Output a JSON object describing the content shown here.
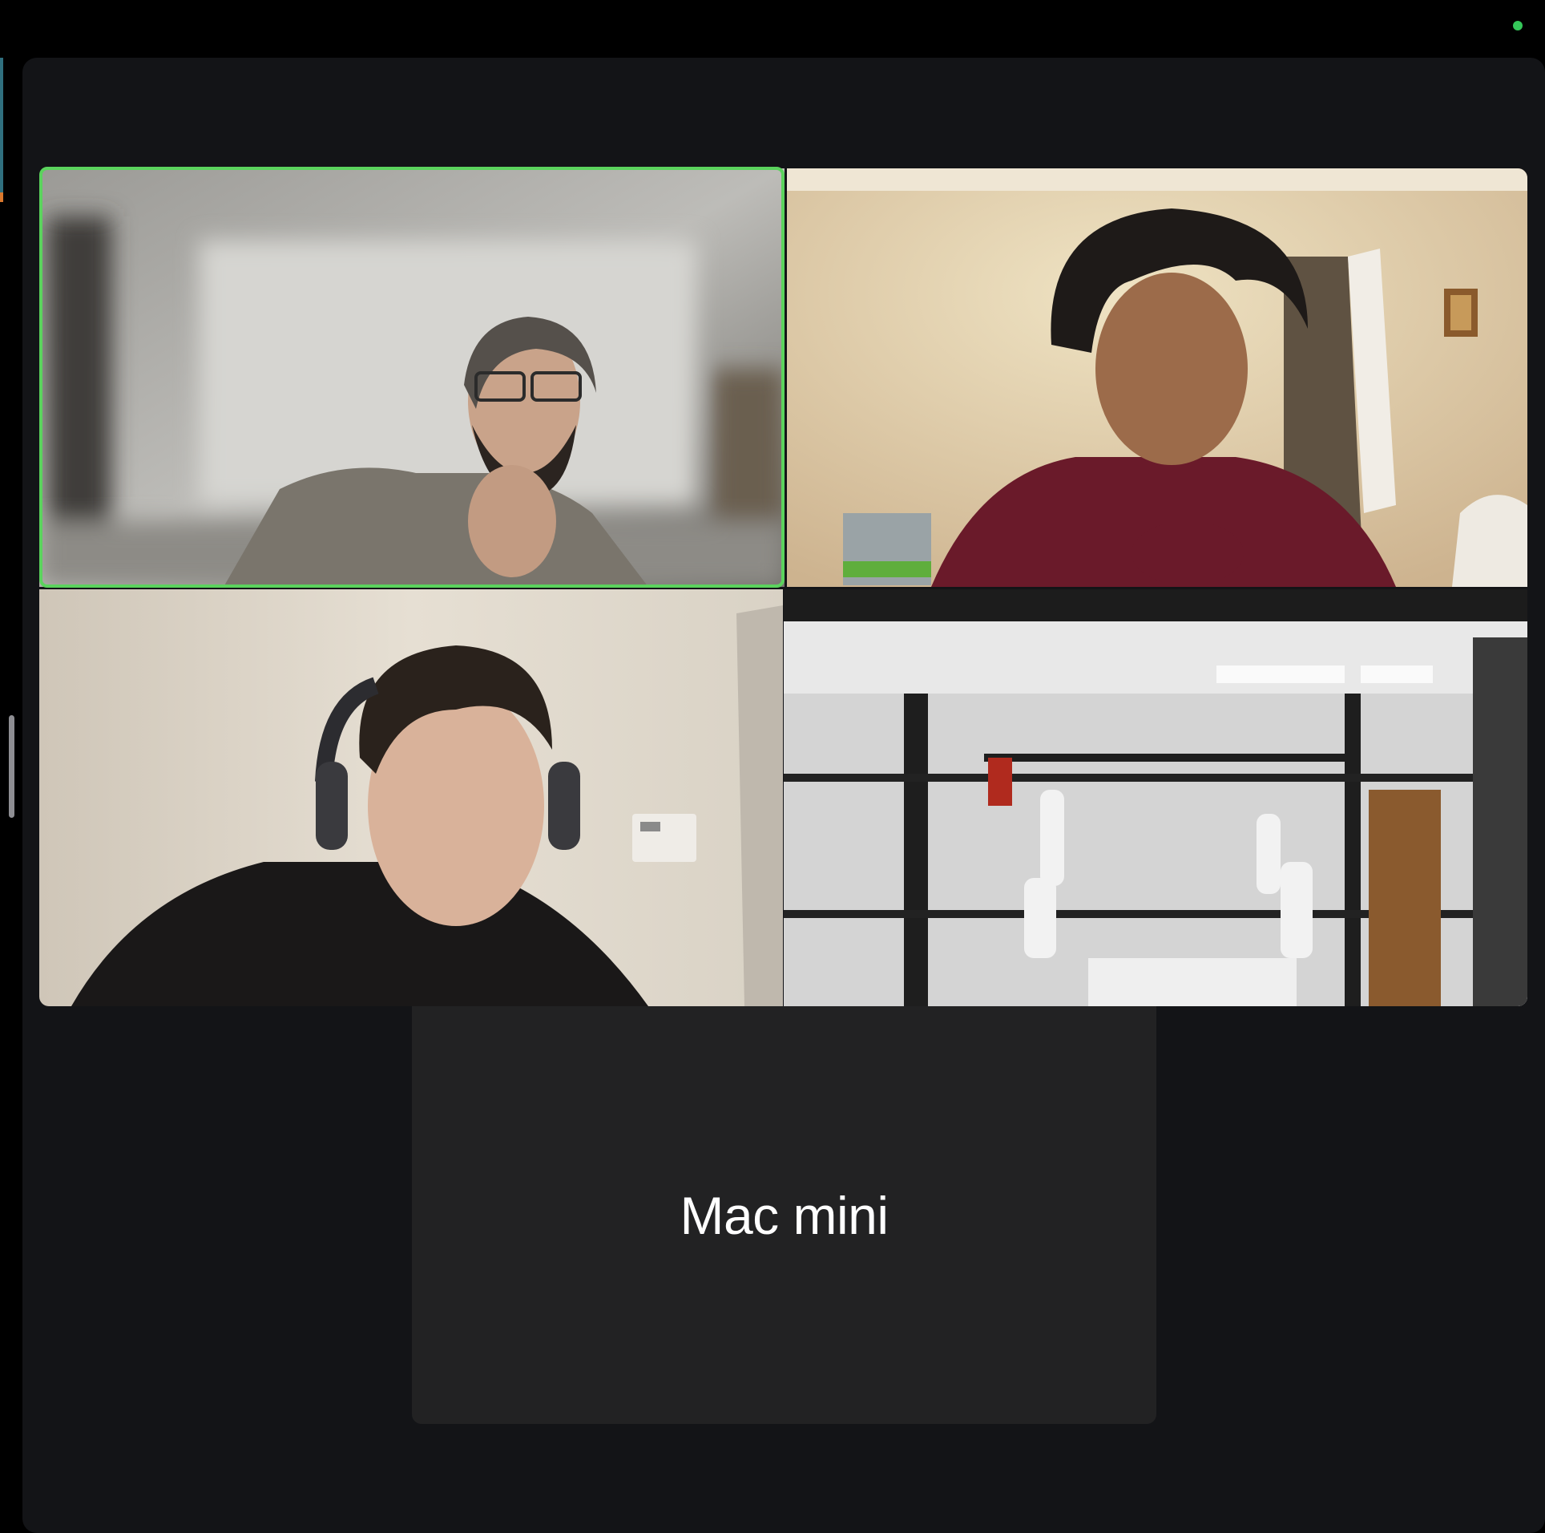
{
  "window": {
    "status_indicator_color": "#34c759",
    "active_speaker_color": "#5bd35d"
  },
  "participants": [
    {
      "tile": 1,
      "video": "on",
      "active_speaker": true,
      "icon": "participant-video"
    },
    {
      "tile": 2,
      "video": "on",
      "active_speaker": false,
      "icon": "participant-video"
    },
    {
      "tile": 3,
      "video": "on",
      "active_speaker": false,
      "icon": "participant-video"
    },
    {
      "tile": 4,
      "video": "on",
      "active_speaker": false,
      "icon": "participant-video"
    },
    {
      "tile": 5,
      "video": "off",
      "active_speaker": false,
      "name": "Mac mini"
    }
  ]
}
